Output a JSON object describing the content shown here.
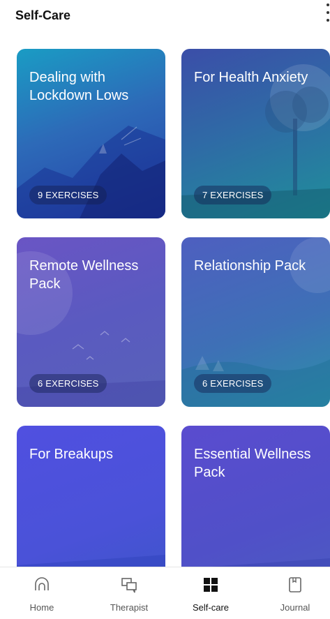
{
  "header": {
    "title": "Self-Care",
    "more_icon": "more-vertical-icon"
  },
  "packs": [
    {
      "title": "Dealing with Lockdown Lows",
      "badge": "9 EXERCISES"
    },
    {
      "title": "For Health Anxiety",
      "badge": "7 EXERCISES"
    },
    {
      "title": "Remote Wellness Pack",
      "badge": "6 EXERCISES"
    },
    {
      "title": "Relationship Pack",
      "badge": "6 EXERCISES"
    },
    {
      "title": "For Breakups",
      "badge": ""
    },
    {
      "title": "Essential Wellness Pack",
      "badge": ""
    }
  ],
  "nav": {
    "items": [
      {
        "label": "Home",
        "icon": "home-icon"
      },
      {
        "label": "Therapist",
        "icon": "chat-icon"
      },
      {
        "label": "Self-care",
        "icon": "grid-icon",
        "active": true
      },
      {
        "label": "Journal",
        "icon": "journal-icon"
      }
    ]
  },
  "colors": {
    "nav_active": "#111111",
    "nav_inactive": "#555555"
  }
}
